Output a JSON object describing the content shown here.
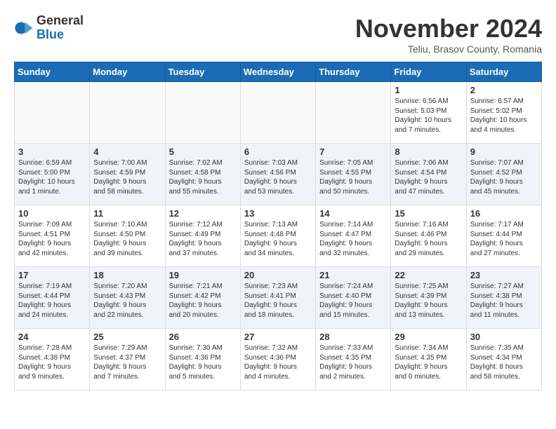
{
  "header": {
    "logo_general": "General",
    "logo_blue": "Blue",
    "month_title": "November 2024",
    "location": "Teliu, Brasov County, Romania"
  },
  "calendar": {
    "days_of_week": [
      "Sunday",
      "Monday",
      "Tuesday",
      "Wednesday",
      "Thursday",
      "Friday",
      "Saturday"
    ],
    "rows": [
      {
        "cells": [
          {
            "day": "",
            "empty": true
          },
          {
            "day": "",
            "empty": true
          },
          {
            "day": "",
            "empty": true
          },
          {
            "day": "",
            "empty": true
          },
          {
            "day": "",
            "empty": true
          },
          {
            "day": "1",
            "info": "Sunrise: 6:56 AM\nSunset: 5:03 PM\nDaylight: 10 hours\nand 7 minutes."
          },
          {
            "day": "2",
            "info": "Sunrise: 6:57 AM\nSunset: 5:02 PM\nDaylight: 10 hours\nand 4 minutes."
          }
        ]
      },
      {
        "cells": [
          {
            "day": "3",
            "info": "Sunrise: 6:59 AM\nSunset: 5:00 PM\nDaylight: 10 hours\nand 1 minute."
          },
          {
            "day": "4",
            "info": "Sunrise: 7:00 AM\nSunset: 4:59 PM\nDaylight: 9 hours\nand 58 minutes."
          },
          {
            "day": "5",
            "info": "Sunrise: 7:02 AM\nSunset: 4:58 PM\nDaylight: 9 hours\nand 55 minutes."
          },
          {
            "day": "6",
            "info": "Sunrise: 7:03 AM\nSunset: 4:56 PM\nDaylight: 9 hours\nand 53 minutes."
          },
          {
            "day": "7",
            "info": "Sunrise: 7:05 AM\nSunset: 4:55 PM\nDaylight: 9 hours\nand 50 minutes."
          },
          {
            "day": "8",
            "info": "Sunrise: 7:06 AM\nSunset: 4:54 PM\nDaylight: 9 hours\nand 47 minutes."
          },
          {
            "day": "9",
            "info": "Sunrise: 7:07 AM\nSunset: 4:52 PM\nDaylight: 9 hours\nand 45 minutes."
          }
        ]
      },
      {
        "cells": [
          {
            "day": "10",
            "info": "Sunrise: 7:09 AM\nSunset: 4:51 PM\nDaylight: 9 hours\nand 42 minutes."
          },
          {
            "day": "11",
            "info": "Sunrise: 7:10 AM\nSunset: 4:50 PM\nDaylight: 9 hours\nand 39 minutes."
          },
          {
            "day": "12",
            "info": "Sunrise: 7:12 AM\nSunset: 4:49 PM\nDaylight: 9 hours\nand 37 minutes."
          },
          {
            "day": "13",
            "info": "Sunrise: 7:13 AM\nSunset: 4:48 PM\nDaylight: 9 hours\nand 34 minutes."
          },
          {
            "day": "14",
            "info": "Sunrise: 7:14 AM\nSunset: 4:47 PM\nDaylight: 9 hours\nand 32 minutes."
          },
          {
            "day": "15",
            "info": "Sunrise: 7:16 AM\nSunset: 4:46 PM\nDaylight: 9 hours\nand 29 minutes."
          },
          {
            "day": "16",
            "info": "Sunrise: 7:17 AM\nSunset: 4:44 PM\nDaylight: 9 hours\nand 27 minutes."
          }
        ]
      },
      {
        "cells": [
          {
            "day": "17",
            "info": "Sunrise: 7:19 AM\nSunset: 4:44 PM\nDaylight: 9 hours\nand 24 minutes."
          },
          {
            "day": "18",
            "info": "Sunrise: 7:20 AM\nSunset: 4:43 PM\nDaylight: 9 hours\nand 22 minutes."
          },
          {
            "day": "19",
            "info": "Sunrise: 7:21 AM\nSunset: 4:42 PM\nDaylight: 9 hours\nand 20 minutes."
          },
          {
            "day": "20",
            "info": "Sunrise: 7:23 AM\nSunset: 4:41 PM\nDaylight: 9 hours\nand 18 minutes."
          },
          {
            "day": "21",
            "info": "Sunrise: 7:24 AM\nSunset: 4:40 PM\nDaylight: 9 hours\nand 15 minutes."
          },
          {
            "day": "22",
            "info": "Sunrise: 7:25 AM\nSunset: 4:39 PM\nDaylight: 9 hours\nand 13 minutes."
          },
          {
            "day": "23",
            "info": "Sunrise: 7:27 AM\nSunset: 4:38 PM\nDaylight: 9 hours\nand 11 minutes."
          }
        ]
      },
      {
        "cells": [
          {
            "day": "24",
            "info": "Sunrise: 7:28 AM\nSunset: 4:38 PM\nDaylight: 9 hours\nand 9 minutes."
          },
          {
            "day": "25",
            "info": "Sunrise: 7:29 AM\nSunset: 4:37 PM\nDaylight: 9 hours\nand 7 minutes."
          },
          {
            "day": "26",
            "info": "Sunrise: 7:30 AM\nSunset: 4:36 PM\nDaylight: 9 hours\nand 5 minutes."
          },
          {
            "day": "27",
            "info": "Sunrise: 7:32 AM\nSunset: 4:36 PM\nDaylight: 9 hours\nand 4 minutes."
          },
          {
            "day": "28",
            "info": "Sunrise: 7:33 AM\nSunset: 4:35 PM\nDaylight: 9 hours\nand 2 minutes."
          },
          {
            "day": "29",
            "info": "Sunrise: 7:34 AM\nSunset: 4:35 PM\nDaylight: 9 hours\nand 0 minutes."
          },
          {
            "day": "30",
            "info": "Sunrise: 7:35 AM\nSunset: 4:34 PM\nDaylight: 8 hours\nand 58 minutes."
          }
        ]
      }
    ]
  }
}
